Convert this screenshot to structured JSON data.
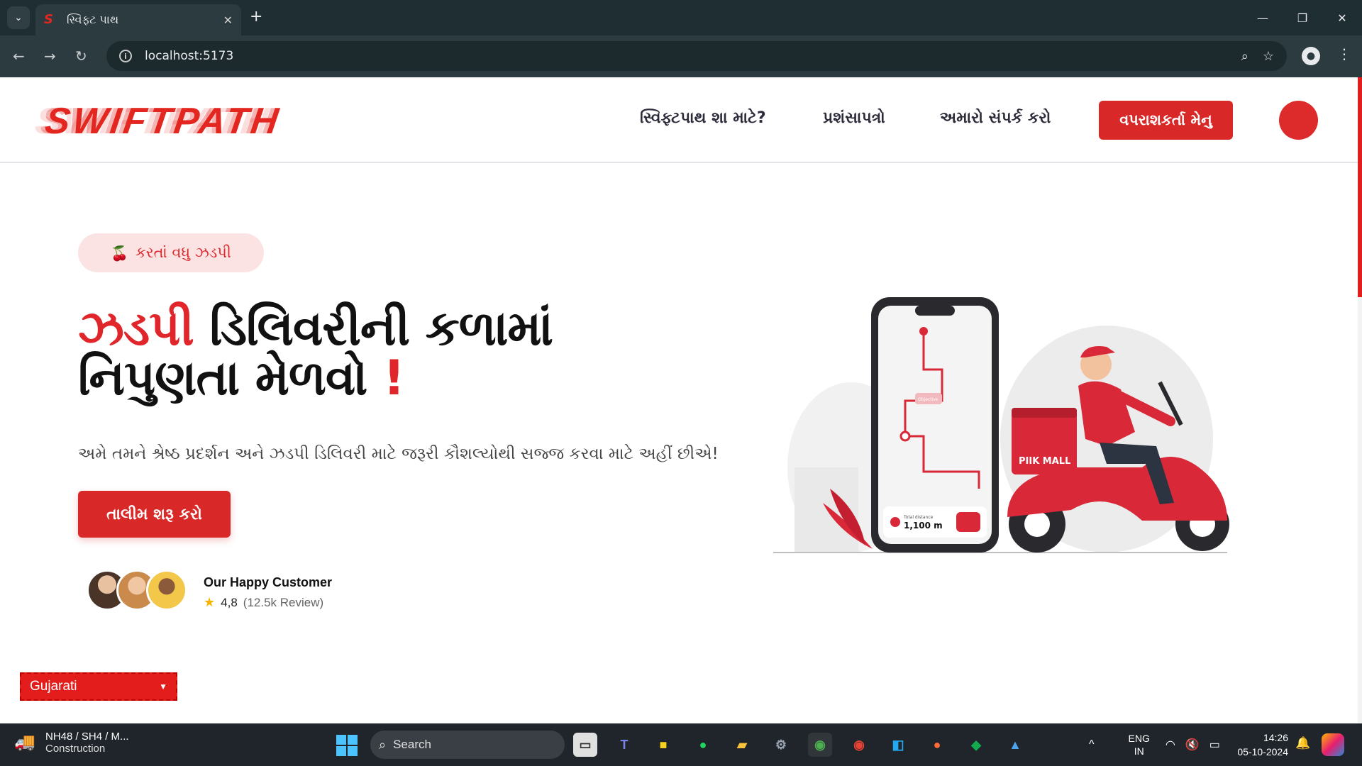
{
  "browser": {
    "tab_title": "સ્વિફ્ટ પાથ",
    "tab_close": "✕",
    "new_tab": "+",
    "url": "localhost:5173",
    "window_controls": [
      "—",
      "❐",
      "✕"
    ]
  },
  "site": {
    "logo": "SWIFTPATH",
    "nav": {
      "why": "સ્વિફ્ટપાથ શા માટે?",
      "testimonials": "પ્રશંસાપત્રો",
      "contact": "અમારો સંપર્ક કરો",
      "user_menu": "વપરાશકર્તા મેનુ"
    },
    "badge": "કરતાં વધુ ઝડપી",
    "hero": {
      "title_accent": "ઝડપી",
      "title_rest_line1": " ડિલિવરીની કળામાં",
      "title_line2": "નિપુણતા મેળવો ",
      "title_exclaim": "!",
      "subtitle": "અમે તમને શ્રેષ્ઠ પ્રદર્શન અને ઝડપી ડિલિવરી માટે જરૂરી કૌશલ્યોથી સજ્જ કરવા માટે અહીં છીએ!",
      "cta": "તાલીમ શરૂ કરો"
    },
    "customers": {
      "title": "Our Happy Customer",
      "rating": "4,8",
      "reviews": "(12.5k Review)"
    },
    "illustration": {
      "box_label": "PIIK MALL",
      "distance_label": "Total distance",
      "distance_value": "1,100 m",
      "pin_label": "Objective"
    },
    "language_select": "Gujarati"
  },
  "taskbar": {
    "weather_line1": "NH48 / SH4 / M...",
    "weather_line2": "Construction",
    "search": "Search",
    "lang_line1": "ENG",
    "lang_line2": "IN",
    "time": "14:26",
    "date": "05-10-2024"
  },
  "colors": {
    "brand_red": "#e0262a",
    "chrome_dark": "#1f2e32",
    "toolbar": "#2b3b3f"
  }
}
